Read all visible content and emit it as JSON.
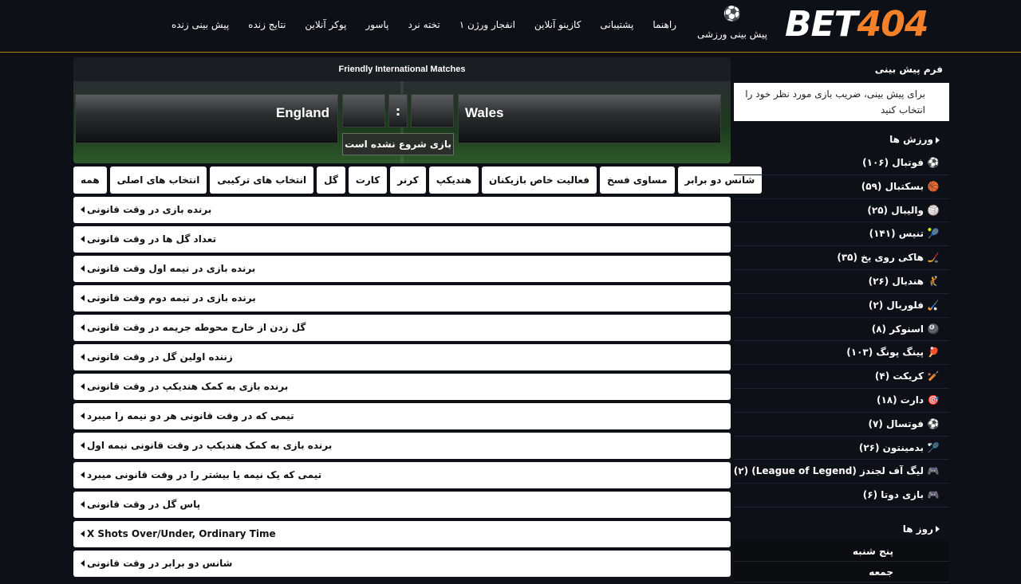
{
  "header": {
    "logo_part1": "BET",
    "logo_part2": "404",
    "sports_label": "پیش بینی ورزشی",
    "nav": [
      "پیش بینی زنده",
      "نتایج زنده",
      "پوکر آنلاین",
      "پاسور",
      "تخته نرد",
      "انفجار ورژن ۱",
      "کازینو آنلاین",
      "پشتیبانی",
      "راهنما"
    ]
  },
  "match": {
    "title": "Friendly International Matches",
    "home_team": "England",
    "away_team": "Wales",
    "score_separator": ":",
    "status": "بازی شروع نشده است"
  },
  "tabs": [
    "همه",
    "انتخاب های اصلی",
    "انتخاب های ترکیبی",
    "گل",
    "کارت",
    "کرنر",
    "هندیکپ",
    "فعالیت خاص بازیکنان",
    "مساوی فسخ",
    "شانس دو برابر"
  ],
  "markets": [
    "برنده بازی در وقت قانونی",
    "تعداد گل ها در وقت قانونی",
    "برنده بازی در نیمه اول وقت قانونی",
    "برنده بازی در نیمه دوم وقت قانونی",
    "گل زدن از خارج محوطه جریمه در وقت قانونی",
    "زننده اولین گل در وقت قانونی",
    "برنده بازی به کمک هندیکپ در وقت قانونی",
    "تیمی که در وقت قانونی هر دو نیمه را میبرد",
    "برنده بازی به کمک هندیکپ در وقت قانونی نیمه اول",
    "تیمی که یک نیمه یا بیشتر را در وقت قانونی میبرد",
    "پاس گل در وقت قانونی",
    "X Shots Over/Under, Ordinary Time",
    "شانس دو برابر در وقت قانونی"
  ],
  "sidebar": {
    "form_title": "فرم پیش بینی",
    "form_hint": "برای پیش بینی، ضریب بازی مورد نظر خود را انتخاب کنید",
    "sports_title": "ورزش ها",
    "sports": [
      {
        "icon": "⚽",
        "label": "فوتبال (۱۰۶)"
      },
      {
        "icon": "🏀",
        "label": "بسکتبال (۵۹)"
      },
      {
        "icon": "🏐",
        "label": "والیبال (۲۵)"
      },
      {
        "icon": "🎾",
        "label": "تنیس (۱۴۱)"
      },
      {
        "icon": "🏒",
        "label": "هاکی روی یخ (۳۵)"
      },
      {
        "icon": "🤾",
        "label": "هندبال (۲۶)"
      },
      {
        "icon": "🏑",
        "label": "فلوربال (۲)"
      },
      {
        "icon": "🎱",
        "label": "اسنوکر (۸)"
      },
      {
        "icon": "🏓",
        "label": "پینگ پونگ (۱۰۳)"
      },
      {
        "icon": "🏏",
        "label": "کریکت (۴)"
      },
      {
        "icon": "🎯",
        "label": "دارت (۱۸)"
      },
      {
        "icon": "⚽",
        "label": "فوتسال (۷)"
      },
      {
        "icon": "🏸",
        "label": "بدمینتون (۲۶)"
      },
      {
        "icon": "🎮",
        "label": "لیگ آف لجندز (League of Legend) (۲)"
      },
      {
        "icon": "🎮",
        "label": "بازی دوتا (۶)"
      }
    ],
    "days_title": "روز ها",
    "days": [
      "پنج شنبه",
      "جمعه"
    ]
  }
}
